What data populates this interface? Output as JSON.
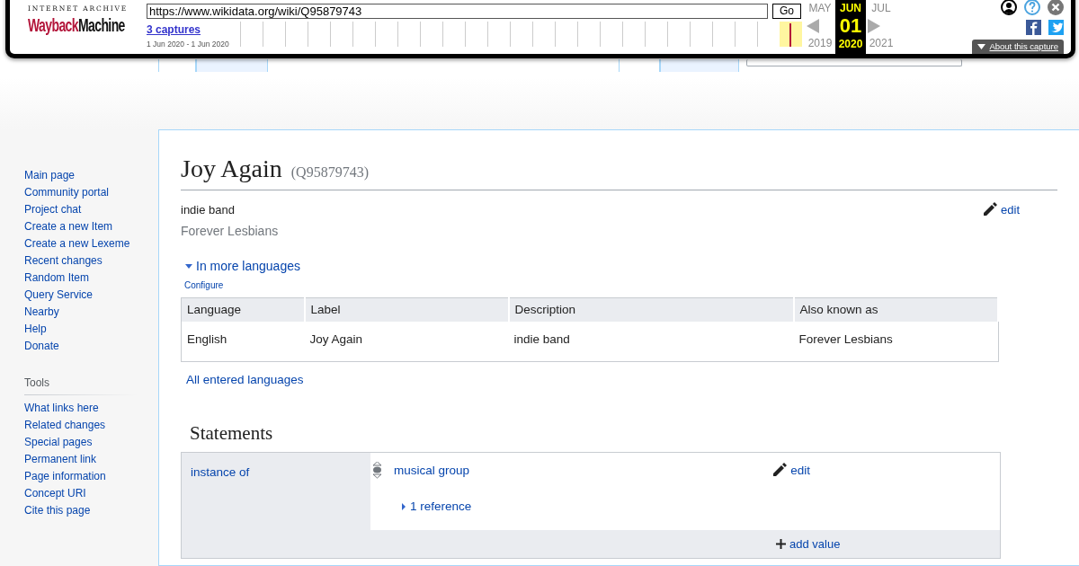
{
  "wayback": {
    "logo_top": "INTERNET ARCHIVE",
    "logo_wayback": "Wayback",
    "logo_machine": "Machine",
    "url": "https://www.wikidata.org/wiki/Q95879743",
    "go": "Go",
    "captures": "3 captures",
    "range": "1 Jun 2020 - 1 Jun 2020",
    "calendar": {
      "prev": {
        "month": "MAY",
        "year": "2019"
      },
      "current": {
        "month": "JUN",
        "day": "01",
        "year": "2020"
      },
      "next": {
        "month": "JUL",
        "year": "2021"
      }
    },
    "about": "About this capture"
  },
  "sidebar": {
    "navigation": [
      "Main page",
      "Community portal",
      "Project chat",
      "Create a new Item",
      "Create a new Lexeme",
      "Recent changes",
      "Random Item",
      "Query Service",
      "Nearby",
      "Help",
      "Donate"
    ],
    "tools_heading": "Tools",
    "tools": [
      "What links here",
      "Related changes",
      "Special pages",
      "Permanent link",
      "Page information",
      "Concept URI",
      "Cite this page"
    ]
  },
  "item": {
    "label": "Joy Again",
    "id": "(Q95879743)",
    "description": "indie band",
    "aliases": "Forever Lesbians",
    "edit": "edit"
  },
  "languages": {
    "toggle": "In more languages",
    "expanded": true,
    "configure": "Configure",
    "columns": [
      "Language",
      "Label",
      "Description",
      "Also known as"
    ],
    "rows": [
      [
        "English",
        "Joy Again",
        "indie band",
        "Forever Lesbians"
      ]
    ],
    "all_link": "All entered languages"
  },
  "statements": {
    "heading": "Statements",
    "groups": [
      {
        "property": "instance of",
        "values": [
          {
            "value": "musical group",
            "edit": "edit",
            "references": "1 reference",
            "references_expanded": false
          }
        ],
        "add": "add value"
      }
    ]
  }
}
